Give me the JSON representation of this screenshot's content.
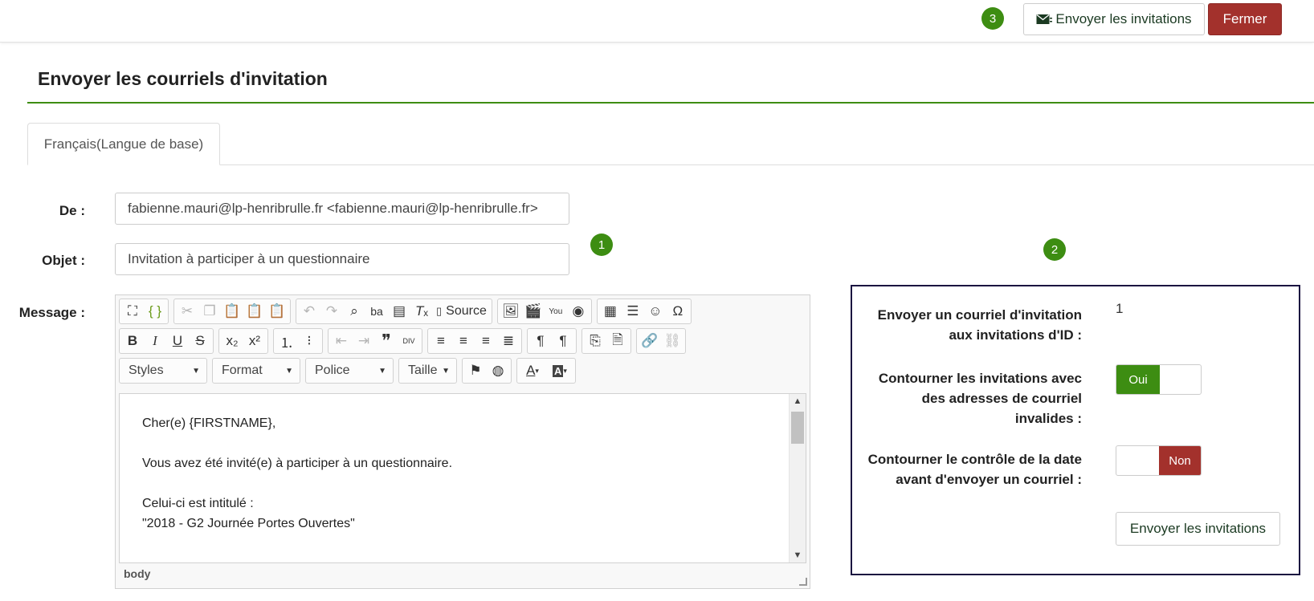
{
  "topbar": {
    "step_badge": "3",
    "send_button_label": "Envoyer les invitations",
    "close_button_label": "Fermer"
  },
  "page": {
    "title": "Envoyer les courriels d'invitation",
    "tab_label": "Français(Langue de base)"
  },
  "form": {
    "from_label": "De :",
    "from_value": "fabienne.mauri@lp-henribrulle.fr <fabienne.mauri@lp-henribrulle.fr>",
    "subject_label": "Objet :",
    "subject_value": "Invitation à participer à un questionnaire",
    "message_label": "Message :",
    "step_badge_1": "1"
  },
  "editor": {
    "source_label": "Source",
    "combos": {
      "styles": "Styles",
      "format": "Format",
      "font": "Police",
      "size": "Taille"
    },
    "content_lines": [
      "Cher(e) {FIRSTNAME},",
      "Vous avez été invité(e) à participer à un questionnaire.",
      "Celui-ci est intitulé :",
      "\"2018 - G2 Journée Portes Ouvertes\""
    ],
    "path": "body"
  },
  "panel": {
    "step_badge_2": "2",
    "ids_label_1": "Envoyer un courriel d'invitation",
    "ids_label_2": "aux invitations d'ID :",
    "ids_value": "1",
    "bypass_label_1": "Contourner les invitations avec",
    "bypass_label_2": "des adresses de courriel",
    "bypass_label_3": "invalides :",
    "bypass_toggle_on": "Oui",
    "date_label_1": "Contourner le contrôle de la date",
    "date_label_2": "avant d'envoyer un courriel :",
    "date_toggle_off": "Non",
    "send_button_label": "Envoyer les invitations"
  },
  "colors": {
    "green": "#3d8d12",
    "red": "#a3312c",
    "panel_border": "#1a1240"
  }
}
